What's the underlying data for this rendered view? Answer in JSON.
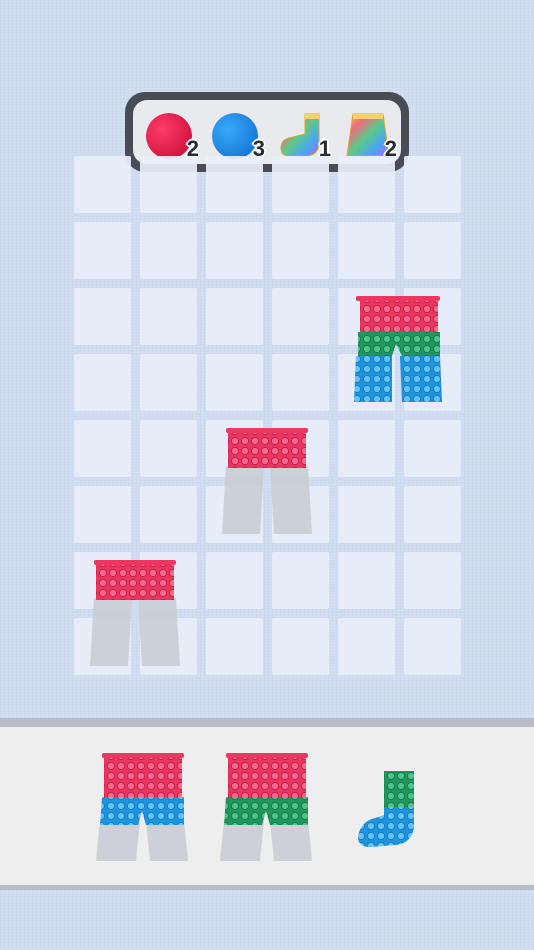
{
  "goals": {
    "items": [
      {
        "name": "red-yarn-ball",
        "count": "2",
        "color": "#e01f4d"
      },
      {
        "name": "blue-yarn-ball",
        "count": "3",
        "color": "#1f8ee8"
      },
      {
        "name": "rainbow-sock",
        "count": "1"
      },
      {
        "name": "rainbow-sweater",
        "count": "2"
      }
    ]
  },
  "board": {
    "rows": 8,
    "cols": 6
  },
  "placed_pieces": [
    {
      "name": "pants",
      "row": 2,
      "col": 4,
      "layers": [
        "pink",
        "green",
        "blue"
      ],
      "complete": true
    },
    {
      "name": "pants",
      "row": 4,
      "col": 2,
      "layers": [
        "pink"
      ],
      "complete": false
    },
    {
      "name": "pants",
      "row": 6,
      "col": 0,
      "layers": [
        "pink"
      ],
      "complete": false
    }
  ],
  "tray": {
    "pieces": [
      {
        "name": "pants",
        "layers": [
          "pink",
          "blue"
        ]
      },
      {
        "name": "pants",
        "layers": [
          "pink",
          "green"
        ]
      },
      {
        "name": "sock",
        "layers": [
          "green",
          "blue"
        ]
      }
    ]
  },
  "colors": {
    "pink": "#ee3f6c",
    "green": "#2ea96e",
    "blue": "#2fa6ea",
    "waistband": "#f03560",
    "background": "#cfdcf0"
  }
}
